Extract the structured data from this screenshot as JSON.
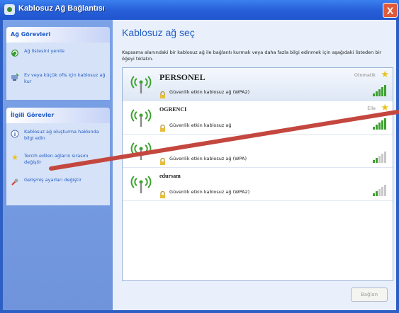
{
  "window": {
    "title": "Kablosuz Ağ Bağlantısı",
    "close_label": "X"
  },
  "sidebar": {
    "network_tasks": {
      "title": "Ağ Görevleri",
      "items": [
        {
          "label": "Ağ listesini yenile",
          "icon": "refresh-icon"
        },
        {
          "label": "Ev veya küçük ofis için kablosuz ağ kur",
          "icon": "network-setup-icon"
        }
      ]
    },
    "related_tasks": {
      "title": "İlgili Görevler",
      "items": [
        {
          "label": "Kablosuz ağ oluşturma hakkında bilgi edin",
          "icon": "info-icon"
        },
        {
          "label": "Tercih edilen ağların sırasını değiştir",
          "icon": "star-icon"
        },
        {
          "label": "Gelişmiş ayarları değiştir",
          "icon": "settings-icon"
        }
      ]
    }
  },
  "main": {
    "heading": "Kablosuz ağ seç",
    "description": "Kapsama alanındaki bir kablosuz ağ ile bağlantı kurmak veya daha fazla bilgi edinmek için aşağıdaki listeden bir öğeyi tıklatın.",
    "networks": [
      {
        "name": "PERSONEL",
        "security": "Güvenlik etkin kablosuz ağ (WPA2)",
        "auto": "Otomatik",
        "starred": true,
        "signal": 5
      },
      {
        "name": "OGRENCI",
        "security": "Güvenlik etkin kablosuz ağ",
        "auto": "Elle",
        "starred": true,
        "signal": 5
      },
      {
        "name": "",
        "security": "Güvenlik etkin kablosuz ağ (WPA)",
        "auto": "",
        "starred": false,
        "signal": 2
      },
      {
        "name": "edursam",
        "security": "Güvenlik etkin kablosuz ağ (WPA2)",
        "auto": "",
        "starred": false,
        "signal": 2
      }
    ],
    "connect_label": "Bağlan"
  },
  "colors": {
    "accent": "#215dc6",
    "titlebar": "#2860d8",
    "signal_on": "#3ca12f",
    "signal_off": "#c8c8c8",
    "overlay_line": "#c4473f"
  }
}
